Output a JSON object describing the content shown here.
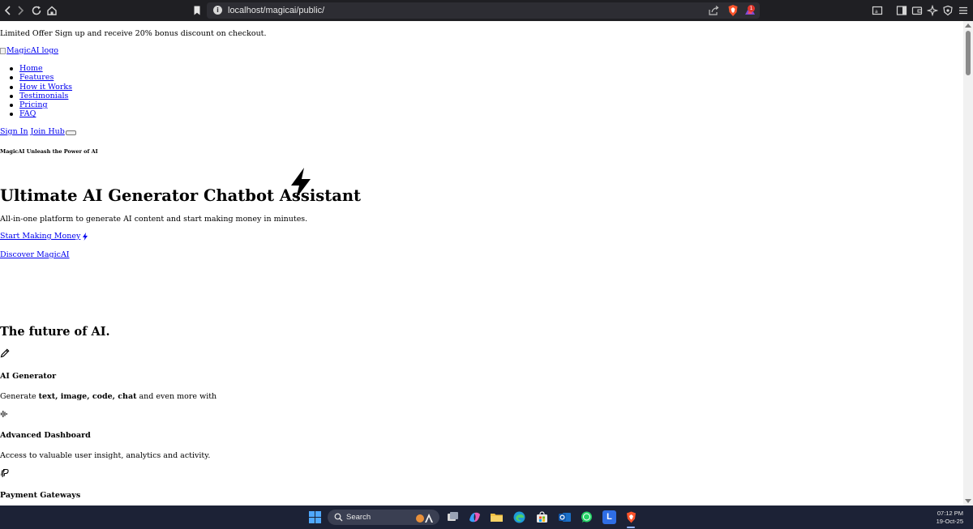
{
  "browser": {
    "url": "localhost/magicai/public/",
    "rewards_badge": "1"
  },
  "page": {
    "offer_text": "Limited Offer Sign up and receive 20% bonus discount on checkout.",
    "logo_alt": "MagicAI logo",
    "nav_items": [
      "Home",
      "Features",
      "How it Works",
      "Testimonials",
      "Pricing",
      "FAQ"
    ],
    "sign_in": "Sign In",
    "join_hub": "Join Hub",
    "eyebrow": "MagicAI Unleash the Power of AI",
    "hero_title": "Ultimate AI Generator Chatbot Assistant",
    "hero_subtitle": "All-in-one platform to generate AI content and start making money in minutes.",
    "cta_primary": "Start Making Money",
    "cta_secondary": "Discover MagicAI",
    "future_title": "The future of AI.",
    "features": [
      {
        "icon": "pencil-icon",
        "title": "AI Generator",
        "desc_prefix": "Generate ",
        "desc_bold_1": "text, image, code, chat",
        "desc_suffix": " and even more with"
      },
      {
        "icon": "waveform-icon",
        "title": "Advanced Dashboard",
        "desc": "Access to valuable user insight, analytics and activity."
      },
      {
        "icon": "paypal-icon",
        "title": "Payment Gateways"
      }
    ]
  },
  "taskbar": {
    "search_placeholder": "Search",
    "time": "07:12 PM",
    "date": "19-Oct-25",
    "apps": [
      "start-icon",
      "search-icon",
      "task-view-icon",
      "copilot-icon",
      "file-explorer-icon",
      "edge-icon",
      "store-icon",
      "outlook-icon",
      "whatsapp-icon",
      "l-app-icon",
      "brave-icon"
    ]
  },
  "colors": {
    "link": "#0000ee",
    "browser_bar": "#1f1f23",
    "address_bar": "#2d2d33",
    "taskbar": "#1c2236",
    "brave_orange": "#fb542b"
  }
}
